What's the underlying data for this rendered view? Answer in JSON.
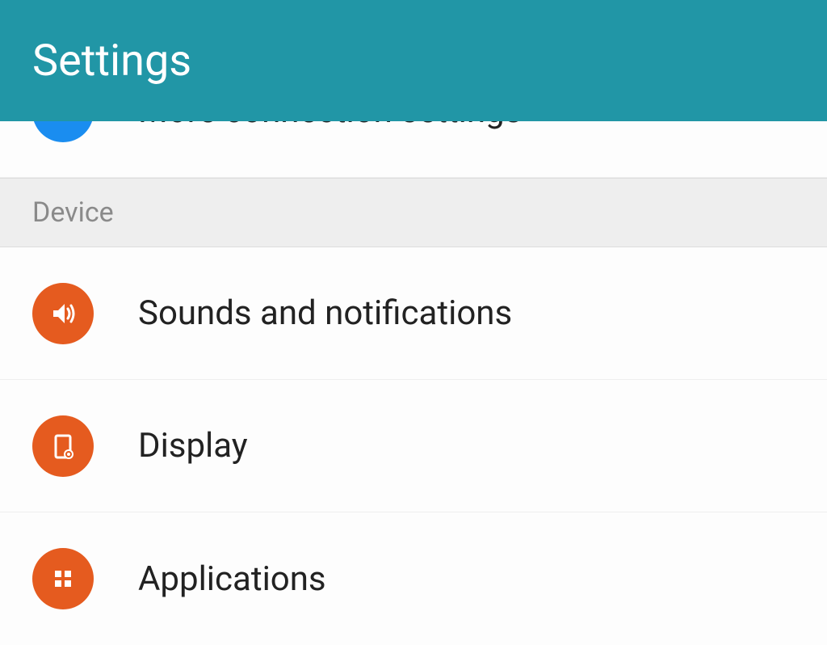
{
  "header": {
    "title": "Settings"
  },
  "colors": {
    "appbar": "#2196a6",
    "icon_orange": "#e55b1f",
    "icon_blue": "#1a8df0",
    "section_bg": "#eeeeee"
  },
  "partial_row": {
    "label": "More connection settings",
    "icon": "more-horizontal-icon",
    "icon_color": "#1a8df0"
  },
  "sections": [
    {
      "title": "Device",
      "items": [
        {
          "label": "Sounds and notifications",
          "icon": "sound-icon",
          "icon_color": "#e55b1f"
        },
        {
          "label": "Display",
          "icon": "display-icon",
          "icon_color": "#e55b1f"
        },
        {
          "label": "Applications",
          "icon": "apps-icon",
          "icon_color": "#e55b1f"
        }
      ]
    }
  ]
}
